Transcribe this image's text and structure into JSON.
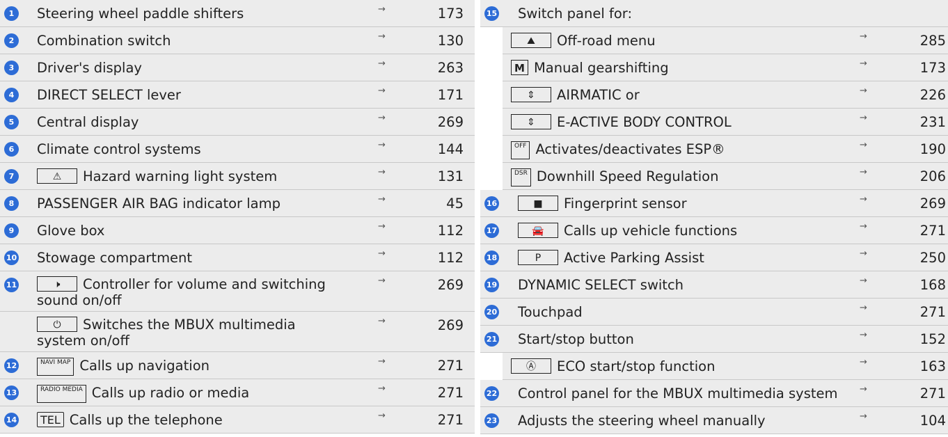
{
  "left": [
    {
      "num": "1",
      "label": "Steering wheel paddle shifters",
      "page": "173"
    },
    {
      "num": "2",
      "label": "Combination switch",
      "page": "130"
    },
    {
      "num": "3",
      "label": "Driver's display",
      "page": "263"
    },
    {
      "num": "4",
      "label": "DIRECT SELECT lever",
      "page": "171"
    },
    {
      "num": "5",
      "label": "Central display",
      "page": "269"
    },
    {
      "num": "6",
      "label": "Climate control systems",
      "page": "144"
    },
    {
      "num": "7",
      "symbol": "⚠",
      "label": "Hazard warning light system",
      "page": "131"
    },
    {
      "num": "8",
      "label": "PASSENGER AIR BAG indicator lamp",
      "page": "45"
    },
    {
      "num": "9",
      "label": "Glove box",
      "page": "112"
    },
    {
      "num": "10",
      "label": "Stowage compartment",
      "page": "112"
    },
    {
      "num": "11",
      "symbol": "🕨",
      "label": "Controller for volume and switching sound on/off",
      "page": "269"
    },
    {
      "num": "",
      "symbol": "⏻",
      "label": "Switches the MBUX multimedia system on/off",
      "page": "269"
    },
    {
      "num": "12",
      "symbol": "NAVI MAP",
      "label": "Calls up navigation",
      "page": "271"
    },
    {
      "num": "13",
      "symbol": "RADIO MEDIA",
      "label": "Calls up radio or media",
      "page": "271"
    },
    {
      "num": "14",
      "symbol": "TEL",
      "label": "Calls up the telephone",
      "page": "271"
    }
  ],
  "right": [
    {
      "num": "15",
      "label": "Switch panel for:",
      "page": "",
      "arrow": false
    },
    {
      "sub": true,
      "symbol": "⛰",
      "label": "Off-road menu",
      "page": "285"
    },
    {
      "sub": true,
      "symbol": "M",
      "label": "Manual gearshifting",
      "page": "173"
    },
    {
      "sub": true,
      "symbol": "⇕",
      "label": "AIRMATIC or",
      "page": "226"
    },
    {
      "sub": true,
      "symbol": "⇕",
      "label": "E-ACTIVE BODY CONTROL",
      "page": "231"
    },
    {
      "sub": true,
      "symbol": "OFF",
      "label": "Activates/deactivates ESP®",
      "page": "190"
    },
    {
      "sub": true,
      "symbol": "DSR",
      "label": "Downhill Speed Regulation",
      "page": "206"
    },
    {
      "num": "16",
      "symbol": "■",
      "label": "Fingerprint sensor",
      "page": "269"
    },
    {
      "num": "17",
      "symbol": "🚘",
      "label": "Calls up vehicle functions",
      "page": "271"
    },
    {
      "num": "18",
      "symbol": "P",
      "label": "Active Parking Assist",
      "page": "250"
    },
    {
      "num": "19",
      "label": "DYNAMIC SELECT switch",
      "page": "168"
    },
    {
      "num": "20",
      "label": "Touchpad",
      "page": "271"
    },
    {
      "num": "21",
      "label": "Start/stop button",
      "page": "152"
    },
    {
      "sub": true,
      "symbol": "Ⓐ",
      "label": "ECO start/stop function",
      "page": "163"
    },
    {
      "num": "22",
      "label": "Control panel for the MBUX multimedia system",
      "page": "271"
    },
    {
      "num": "23",
      "label": "Adjusts the steering wheel manually",
      "page": "104"
    }
  ],
  "arrow": "→"
}
